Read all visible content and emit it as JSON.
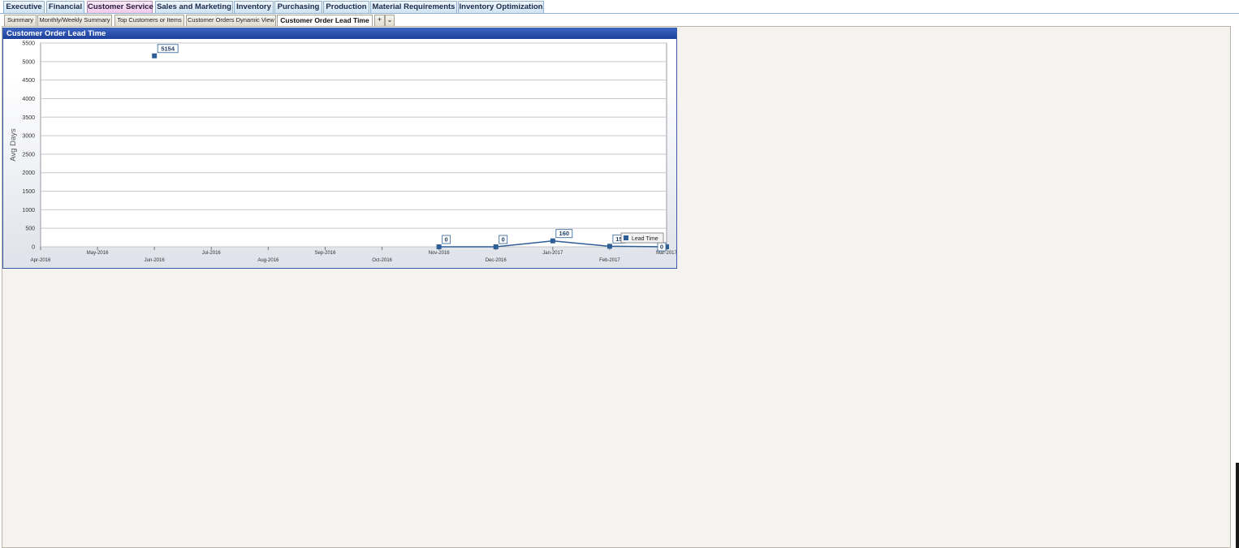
{
  "top_tabs": [
    "Executive",
    "Financial",
    "Customer Service",
    "Sales and Marketing",
    "Inventory",
    "Purchasing",
    "Production",
    "Material Requirements",
    "Inventory Optimization"
  ],
  "sub_tabs": [
    "Summary",
    "Monthly/Weekly Summary",
    "Top Customers or Items",
    "Customer Orders Dynamic View",
    "Customer Order Lead Time"
  ],
  "sub_tab_add": "+",
  "sub_tab_menu": "⌄",
  "panel_title": "Customer Order Lead Time",
  "colors": {
    "series": "#2e5e96",
    "header": "#2a4fad",
    "active_tab": "#f1c9ea"
  },
  "chart_data": {
    "type": "line",
    "title": "",
    "xlabel": "",
    "ylabel": "Avg Days",
    "ylim": [
      0,
      5500
    ],
    "y_ticks": [
      0,
      500,
      1000,
      1500,
      2000,
      2500,
      3000,
      3500,
      4000,
      4500,
      5000,
      5500
    ],
    "categories": [
      "Apr-2016",
      "May-2016",
      "Jun-2016",
      "Jul-2016",
      "Aug-2016",
      "Sep-2016",
      "Oct-2016",
      "Nov-2016",
      "Dec-2016",
      "Jan-2017",
      "Feb-2017",
      "Mar-2017"
    ],
    "grid": true,
    "legend": "bottom-right",
    "series": [
      {
        "name": "Lead Time",
        "points": [
          {
            "x": "Jun-2016",
            "y": 5154,
            "label": "5154"
          },
          {
            "x": "Nov-2016",
            "y": 0,
            "label": "0"
          },
          {
            "x": "Dec-2016",
            "y": 0,
            "label": "0"
          },
          {
            "x": "Jan-2017",
            "y": 160,
            "label": "160"
          },
          {
            "x": "Feb-2017",
            "y": 15,
            "label": "15"
          },
          {
            "x": "Mar-2017",
            "y": 0,
            "label": "0"
          }
        ]
      }
    ]
  }
}
